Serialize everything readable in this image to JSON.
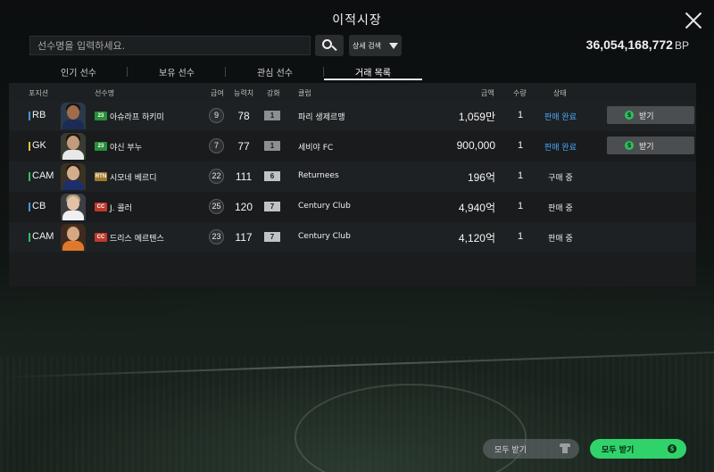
{
  "window": {
    "title": "이적시장"
  },
  "search": {
    "placeholder": "선수명을 입력하세요.",
    "value": ""
  },
  "filter": {
    "detail_label": "상세 검색"
  },
  "balance": {
    "amount": "36,054,168,772",
    "unit": "BP"
  },
  "tabs": [
    {
      "label": "인기 선수",
      "active": false
    },
    {
      "label": "보유 선수",
      "active": false
    },
    {
      "label": "관심 선수",
      "active": false
    },
    {
      "label": "거래 목록",
      "active": true
    }
  ],
  "columns": {
    "position": "포지션",
    "name": "선수명",
    "salary": "급여",
    "ovr": "능력치",
    "grade": "강화",
    "club": "클럽",
    "price": "금액",
    "qty": "수량",
    "status": "상태"
  },
  "rows": [
    {
      "position": "RB",
      "pos_color": "#4a90e2",
      "season": "23",
      "season_color": "#2a8f3a",
      "name": "아슈라프 하키미",
      "salary": "9",
      "ovr": "78",
      "grade": "1",
      "grade_color": "#8a8f92",
      "club": "파리 생제르맹",
      "price": "1,059만",
      "qty": "1",
      "status": "판매 완료",
      "status_type": "done",
      "receive_label": "받기"
    },
    {
      "position": "GK",
      "pos_color": "#e8c23a",
      "season": "23",
      "season_color": "#2a8f3a",
      "name": "야신 부누",
      "salary": "7",
      "ovr": "77",
      "grade": "1",
      "grade_color": "#8a8f92",
      "club": "세비야 FC",
      "price": "900,000",
      "qty": "1",
      "status": "판매 완료",
      "status_type": "done",
      "receive_label": "받기"
    },
    {
      "position": "CAM",
      "pos_color": "#2fbf5e",
      "season": "RTN",
      "season_color": "#a07a2c",
      "name": "시모네 베르디",
      "salary": "22",
      "ovr": "111",
      "grade": "6",
      "grade_color": "#c0c3c5",
      "club": "Returnees",
      "price": "196억",
      "qty": "1",
      "status": "구매 중",
      "status_type": "pending"
    },
    {
      "position": "CB",
      "pos_color": "#4a90e2",
      "season": "CC",
      "season_color": "#c0392b",
      "name": "J. 콜러",
      "salary": "25",
      "ovr": "120",
      "grade": "7",
      "grade_color": "#c0c3c5",
      "club": "Century Club",
      "price": "4,940억",
      "qty": "1",
      "status": "판매 중",
      "status_type": "pending"
    },
    {
      "position": "CAM",
      "pos_color": "#2fbf5e",
      "season": "CC",
      "season_color": "#c0392b",
      "name": "드리스 메르텐스",
      "salary": "23",
      "ovr": "117",
      "grade": "7",
      "grade_color": "#c0c3c5",
      "club": "Century Club",
      "price": "4,120억",
      "qty": "1",
      "status": "판매 중",
      "status_type": "pending"
    }
  ],
  "footer": {
    "receive_all_disabled": "모두 받기",
    "receive_all": "모두 받기"
  },
  "colors": {
    "accent_green": "#2fd36a",
    "status_done": "#4aa8ff"
  }
}
